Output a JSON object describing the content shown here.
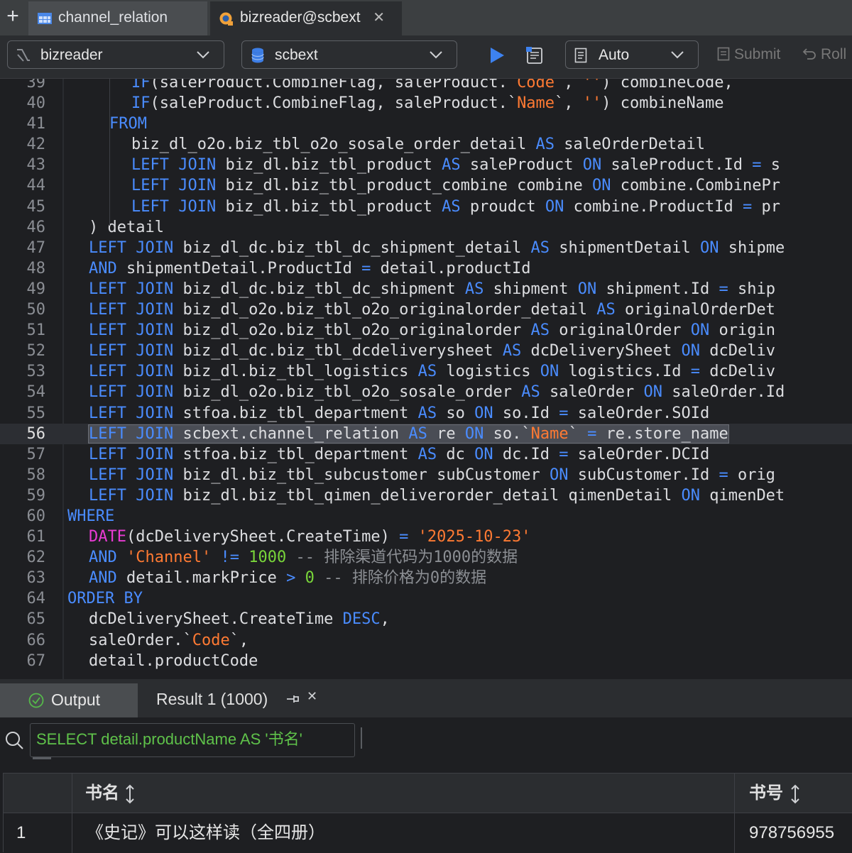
{
  "tabs": [
    {
      "label": "channel_relation",
      "icon": "table-grid-icon",
      "active": false
    },
    {
      "label": "bizreader@scbext",
      "icon": "console-icon",
      "active": true
    }
  ],
  "toolbar": {
    "datasource": "bizreader",
    "schema": "scbext",
    "tx_mode": "Auto",
    "submit_label": "Submit",
    "rollback_label": "Roll"
  },
  "editor": {
    "highlighted_line": 56,
    "lines": [
      {
        "n": "39",
        "text": "IF(saleProduct.CombineFlag, saleProduct.`Code`, '') combineCode,"
      },
      {
        "n": "40",
        "text": "IF(saleProduct.CombineFlag, saleProduct.`Name`, '') combineName"
      },
      {
        "n": "41",
        "text": "FROM"
      },
      {
        "n": "42",
        "text": "biz_dl_o2o.biz_tbl_o2o_sosale_order_detail AS saleOrderDetail"
      },
      {
        "n": "43",
        "text": "LEFT JOIN biz_dl.biz_tbl_product AS saleProduct ON saleProduct.Id = s"
      },
      {
        "n": "44",
        "text": "LEFT JOIN biz_dl.biz_tbl_product_combine combine ON combine.CombinePr"
      },
      {
        "n": "45",
        "text": "LEFT JOIN biz_dl.biz_tbl_product AS proudct ON combine.ProductId = pr"
      },
      {
        "n": "46",
        "text": ") detail"
      },
      {
        "n": "47",
        "text": "LEFT JOIN biz_dl_dc.biz_tbl_dc_shipment_detail AS shipmentDetail ON shipme"
      },
      {
        "n": "48",
        "text": "AND shipmentDetail.ProductId = detail.productId"
      },
      {
        "n": "49",
        "text": "LEFT JOIN biz_dl_dc.biz_tbl_dc_shipment AS shipment ON shipment.Id = ship"
      },
      {
        "n": "50",
        "text": "LEFT JOIN biz_dl_o2o.biz_tbl_o2o_originalorder_detail AS originalOrderDet"
      },
      {
        "n": "51",
        "text": "LEFT JOIN biz_dl_o2o.biz_tbl_o2o_originalorder AS originalOrder ON origin"
      },
      {
        "n": "52",
        "text": "LEFT JOIN biz_dl_dc.biz_tbl_dcdeliverysheet AS dcDeliverySheet ON dcDeliv"
      },
      {
        "n": "53",
        "text": "LEFT JOIN biz_dl.biz_tbl_logistics AS logistics ON logistics.Id = dcDeliv"
      },
      {
        "n": "54",
        "text": "LEFT JOIN biz_dl_o2o.biz_tbl_o2o_sosale_order AS saleOrder ON saleOrder.Id"
      },
      {
        "n": "55",
        "text": "LEFT JOIN stfoa.biz_tbl_department AS so ON so.Id = saleOrder.SOId"
      },
      {
        "n": "56",
        "text": "LEFT JOIN scbext.channel_relation AS re ON so.`Name` = re.store_name"
      },
      {
        "n": "57",
        "text": "LEFT JOIN stfoa.biz_tbl_department AS dc ON dc.Id = saleOrder.DCId"
      },
      {
        "n": "58",
        "text": "LEFT JOIN biz_dl.biz_tbl_subcustomer subCustomer ON subCustomer.Id = orig"
      },
      {
        "n": "59",
        "text": "LEFT JOIN biz_dl.biz_tbl_qimen_deliverorder_detail qimenDetail ON qimenDet"
      },
      {
        "n": "60",
        "text": "WHERE"
      },
      {
        "n": "61",
        "text": "DATE(dcDeliverySheet.CreateTime) = '2025-10-23'"
      },
      {
        "n": "62",
        "text": "AND 'Channel' != 1000 -- 排除渠道代码为1000的数据"
      },
      {
        "n": "63",
        "text": "AND detail.markPrice > 0 -- 排除价格为0的数据"
      },
      {
        "n": "64",
        "text": "ORDER BY"
      },
      {
        "n": "65",
        "text": "dcDeliverySheet.CreateTime DESC,"
      },
      {
        "n": "66",
        "text": "saleOrder.`Code`,"
      },
      {
        "n": "67",
        "text": "detail.productCode"
      }
    ]
  },
  "output_tabs": [
    {
      "label": "Output",
      "icon": "check-circle-icon",
      "active": true
    },
    {
      "label": "Result 1 (1000)",
      "icon": "pin-icon",
      "active": false
    }
  ],
  "filter": {
    "value": "SELECT detail.productName AS '书名'"
  },
  "grid": {
    "columns": [
      "书名",
      "书号"
    ],
    "rows": [
      {
        "index": "1",
        "cells": [
          "《史记》可以这样读（全四册）",
          "978756955"
        ]
      }
    ]
  },
  "colors": {
    "keyword": "#4a8cff",
    "string": "#ff7a33",
    "number": "#79d63a",
    "function": "#e93bd3",
    "comment": "#8c8f94"
  }
}
